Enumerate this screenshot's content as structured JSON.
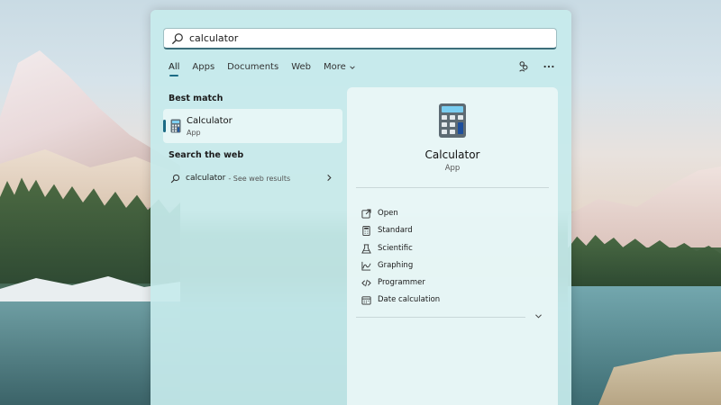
{
  "search": {
    "query": "calculator"
  },
  "tabs": [
    {
      "label": "All",
      "active": true
    },
    {
      "label": "Apps"
    },
    {
      "label": "Documents"
    },
    {
      "label": "Web"
    },
    {
      "label": "More"
    }
  ],
  "sections": {
    "best_match": "Best match",
    "search_web": "Search the web"
  },
  "best_match": {
    "title": "Calculator",
    "type": "App"
  },
  "web_result": {
    "query": "calculator",
    "suffix": "- See web results"
  },
  "detail": {
    "title": "Calculator",
    "type": "App",
    "actions": [
      {
        "label": "Open",
        "icon": "open-external-icon"
      },
      {
        "label": "Standard",
        "icon": "calculator-icon"
      },
      {
        "label": "Scientific",
        "icon": "flask-icon"
      },
      {
        "label": "Graphing",
        "icon": "graph-icon"
      },
      {
        "label": "Programmer",
        "icon": "code-icon"
      },
      {
        "label": "Date calculation",
        "icon": "calendar-icon"
      }
    ]
  },
  "colors": {
    "accent": "#1b6b85",
    "panel": "#c6ebec",
    "detail": "#ecf7f7"
  }
}
